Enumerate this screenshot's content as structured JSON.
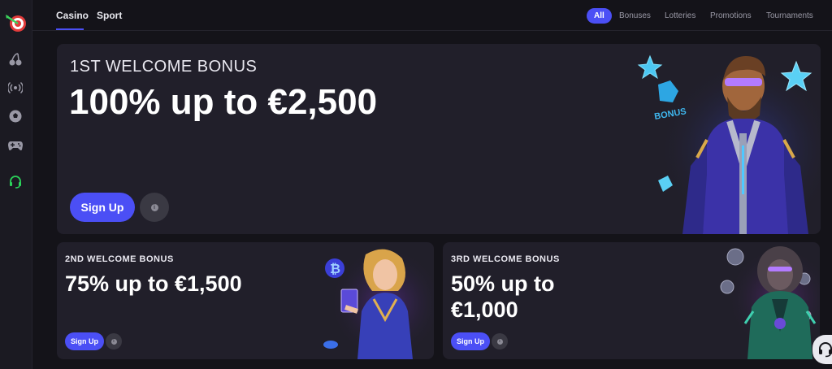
{
  "top_tabs": [
    {
      "label": "Casino",
      "active": true
    },
    {
      "label": "Sport",
      "active": false
    }
  ],
  "filters": [
    {
      "label": "All",
      "active": true
    },
    {
      "label": "Bonuses",
      "active": false
    },
    {
      "label": "Lotteries",
      "active": false
    },
    {
      "label": "Promotions",
      "active": false
    },
    {
      "label": "Tournaments",
      "active": false
    }
  ],
  "sidebar": {
    "icons": [
      "target-logo-icon",
      "cherries-icon",
      "broadcast-icon",
      "soccer-ball-icon",
      "gamepad-icon",
      "support-agent-icon"
    ]
  },
  "bonus1": {
    "eyebrow": "1ST WELCOME BONUS",
    "headline": "100% up to €2,500",
    "cta": "Sign Up"
  },
  "bonus2": {
    "eyebrow": "2ND WELCOME BONUS",
    "headline": "75% up to €1,500",
    "cta": "Sign Up"
  },
  "bonus3": {
    "eyebrow": "3RD WELCOME BONUS",
    "headline_line1": "50% up to",
    "headline_line2": "€1,000",
    "cta": "Sign Up"
  },
  "info_symbol": "i",
  "colors": {
    "accent": "#4b4ff5",
    "background": "#141319",
    "card": "#211f2a",
    "support_green": "#2bd45a"
  }
}
